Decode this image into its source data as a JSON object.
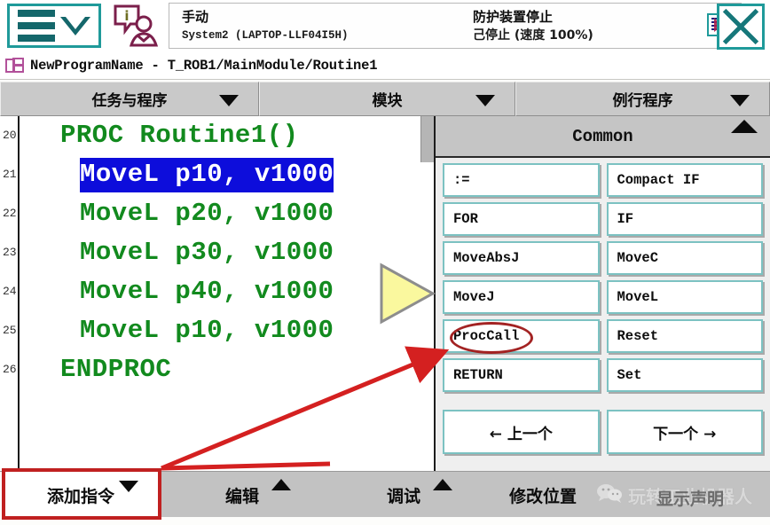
{
  "header": {
    "menu_icon": "hamburger-menu-icon",
    "menu_chevron": "chevron-down-icon",
    "operator_icon": "operator-info-icon",
    "mode_label": "手动",
    "system_label": "System2 (LAPTOP-LLF04I5H)",
    "protection_label": "防护装置停止",
    "run_state_label": "己停止 (速度 100%)",
    "tray_icon": "program-pointer-icon",
    "close_icon": "close-icon"
  },
  "pathbar": {
    "icon": "program-module-icon",
    "text": "NewProgramName - T_ROB1/MainModule/Routine1"
  },
  "dropdowns": [
    {
      "label": "任务与程序",
      "caret": "caret-down-icon"
    },
    {
      "label": "模块",
      "caret": "caret-down-icon"
    },
    {
      "label": "例行程序",
      "caret": "caret-down-icon"
    }
  ],
  "code": {
    "lines": [
      {
        "num": "20",
        "text": "PROC Routine1()",
        "indent": 1,
        "selected": false
      },
      {
        "num": "21",
        "text": "MoveL p10, v1000",
        "indent": 2,
        "selected": true
      },
      {
        "num": "22",
        "text": "MoveL p20, v1000",
        "indent": 2,
        "selected": false
      },
      {
        "num": "23",
        "text": "MoveL p30, v1000",
        "indent": 2,
        "selected": false
      },
      {
        "num": "24",
        "text": "MoveL p40, v1000",
        "indent": 2,
        "selected": false
      },
      {
        "num": "25",
        "text": "MoveL p10, v1000",
        "indent": 2,
        "selected": false
      },
      {
        "num": "26",
        "text": "ENDPROC",
        "indent": 1,
        "selected": false
      }
    ],
    "cursor_icon": "play-cursor-triangle-icon",
    "selection_bg": "#0d0ddb",
    "text_color": "#128a1e"
  },
  "instruction_panel": {
    "title": "Common",
    "collapse_caret": "caret-up-icon",
    "buttons": [
      {
        "label": ":=",
        "highlighted": false
      },
      {
        "label": "Compact IF",
        "highlighted": false
      },
      {
        "label": "FOR",
        "highlighted": false
      },
      {
        "label": "IF",
        "highlighted": false
      },
      {
        "label": "MoveAbsJ",
        "highlighted": false
      },
      {
        "label": "MoveC",
        "highlighted": false
      },
      {
        "label": "MoveJ",
        "highlighted": false
      },
      {
        "label": "MoveL",
        "highlighted": false
      },
      {
        "label": "ProcCall",
        "highlighted": true
      },
      {
        "label": "Reset",
        "highlighted": false
      },
      {
        "label": "RETURN",
        "highlighted": false
      },
      {
        "label": "Set",
        "highlighted": false
      }
    ],
    "nav": [
      {
        "label": "←  上一个"
      },
      {
        "label": "下一个  →"
      }
    ]
  },
  "bottombar": {
    "buttons": [
      {
        "label": "添加指令",
        "caret": "caret-down-icon",
        "active": true
      },
      {
        "label": "编辑",
        "caret": "caret-up-icon",
        "active": false
      },
      {
        "label": "调试",
        "caret": "caret-up-icon",
        "active": false
      },
      {
        "label": "修改位置",
        "caret": "none",
        "active": false
      }
    ]
  },
  "annotations": {
    "highlight_color": "#c02020",
    "ellipse_target": "ProcCall",
    "framed_button": "添加指令"
  },
  "watermark": {
    "icon": "wechat-icon",
    "text": "玩转工业机器人",
    "overlay_text": "显示声明"
  }
}
